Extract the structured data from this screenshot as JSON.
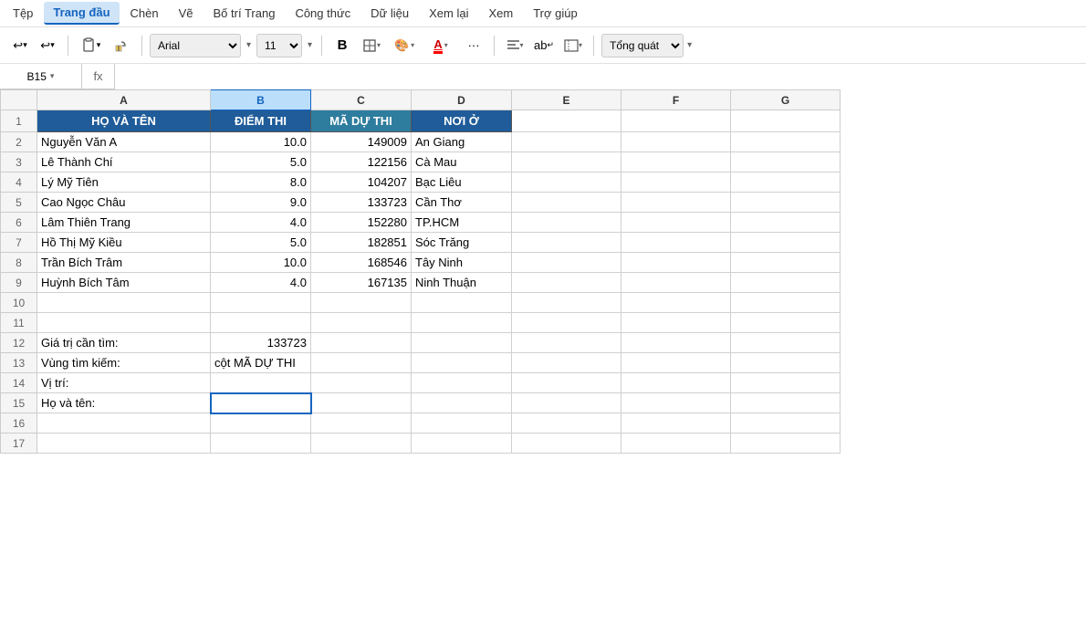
{
  "menu": {
    "items": [
      {
        "label": "Tệp",
        "active": false
      },
      {
        "label": "Trang đầu",
        "active": true
      },
      {
        "label": "Chèn",
        "active": false
      },
      {
        "label": "Vẽ",
        "active": false
      },
      {
        "label": "Bố trí Trang",
        "active": false
      },
      {
        "label": "Công thức",
        "active": false
      },
      {
        "label": "Dữ liệu",
        "active": false
      },
      {
        "label": "Xem lại",
        "active": false
      },
      {
        "label": "Xem",
        "active": false
      },
      {
        "label": "Trợ giúp",
        "active": false
      }
    ]
  },
  "toolbar": {
    "font": "Arial",
    "font_size": "11",
    "bold_label": "B",
    "view_label": "Tổng quát"
  },
  "formula_bar": {
    "cell_ref": "B15",
    "fx_label": "fx",
    "formula_value": ""
  },
  "columns": {
    "corner": "",
    "headers": [
      "A",
      "B",
      "C",
      "D",
      "E",
      "F",
      "G"
    ]
  },
  "header_row": {
    "row_num": "1",
    "col_a": "HỌ VÀ TÊN",
    "col_b": "ĐIỂM THI",
    "col_c": "MÃ DỰ THI",
    "col_d": "NƠI Ở",
    "col_e": "",
    "col_f": "",
    "col_g": ""
  },
  "data_rows": [
    {
      "row": "2",
      "a": "Nguyễn Văn A",
      "b": "10.0",
      "c": "149009",
      "d": "An Giang",
      "e": "",
      "f": "",
      "g": ""
    },
    {
      "row": "3",
      "a": "Lê Thành Chí",
      "b": "5.0",
      "c": "122156",
      "d": "Cà Mau",
      "e": "",
      "f": "",
      "g": ""
    },
    {
      "row": "4",
      "a": "Lý Mỹ Tiên",
      "b": "8.0",
      "c": "104207",
      "d": "Bạc Liêu",
      "e": "",
      "f": "",
      "g": ""
    },
    {
      "row": "5",
      "a": "Cao Ngọc Châu",
      "b": "9.0",
      "c": "133723",
      "d": "Cần Thơ",
      "e": "",
      "f": "",
      "g": ""
    },
    {
      "row": "6",
      "a": "Lâm Thiên Trang",
      "b": "4.0",
      "c": "152280",
      "d": "TP.HCM",
      "e": "",
      "f": "",
      "g": ""
    },
    {
      "row": "7",
      "a": "Hồ Thị Mỹ Kiều",
      "b": "5.0",
      "c": "182851",
      "d": "Sóc Trăng",
      "e": "",
      "f": "",
      "g": ""
    },
    {
      "row": "8",
      "a": "Trần Bích Trâm",
      "b": "10.0",
      "c": "168546",
      "d": "Tây Ninh",
      "e": "",
      "f": "",
      "g": ""
    },
    {
      "row": "9",
      "a": "Huỳnh Bích Tâm",
      "b": "4.0",
      "c": "167135",
      "d": "Ninh Thuận",
      "e": "",
      "f": "",
      "g": ""
    }
  ],
  "empty_rows": [
    "10",
    "11"
  ],
  "extra_rows": [
    {
      "row": "12",
      "a": "Giá trị cần tìm:",
      "b": "133723",
      "c": "",
      "d": "",
      "e": "",
      "f": "",
      "g": ""
    },
    {
      "row": "13",
      "a": "Vùng tìm kiếm:",
      "b": "cột MÃ DỰ THI",
      "c": "",
      "d": "",
      "e": "",
      "f": "",
      "g": ""
    },
    {
      "row": "14",
      "a": "Vị trí:",
      "b": "",
      "c": "",
      "d": "",
      "e": "",
      "f": "",
      "g": ""
    },
    {
      "row": "15",
      "a": "Họ và tên:",
      "b": "",
      "c": "",
      "d": "",
      "e": "",
      "f": "",
      "g": ""
    },
    {
      "row": "16",
      "a": "",
      "b": "",
      "c": "",
      "d": "",
      "e": "",
      "f": "",
      "g": ""
    },
    {
      "row": "17",
      "a": "",
      "b": "",
      "c": "",
      "d": "",
      "e": "",
      "f": "",
      "g": ""
    }
  ]
}
